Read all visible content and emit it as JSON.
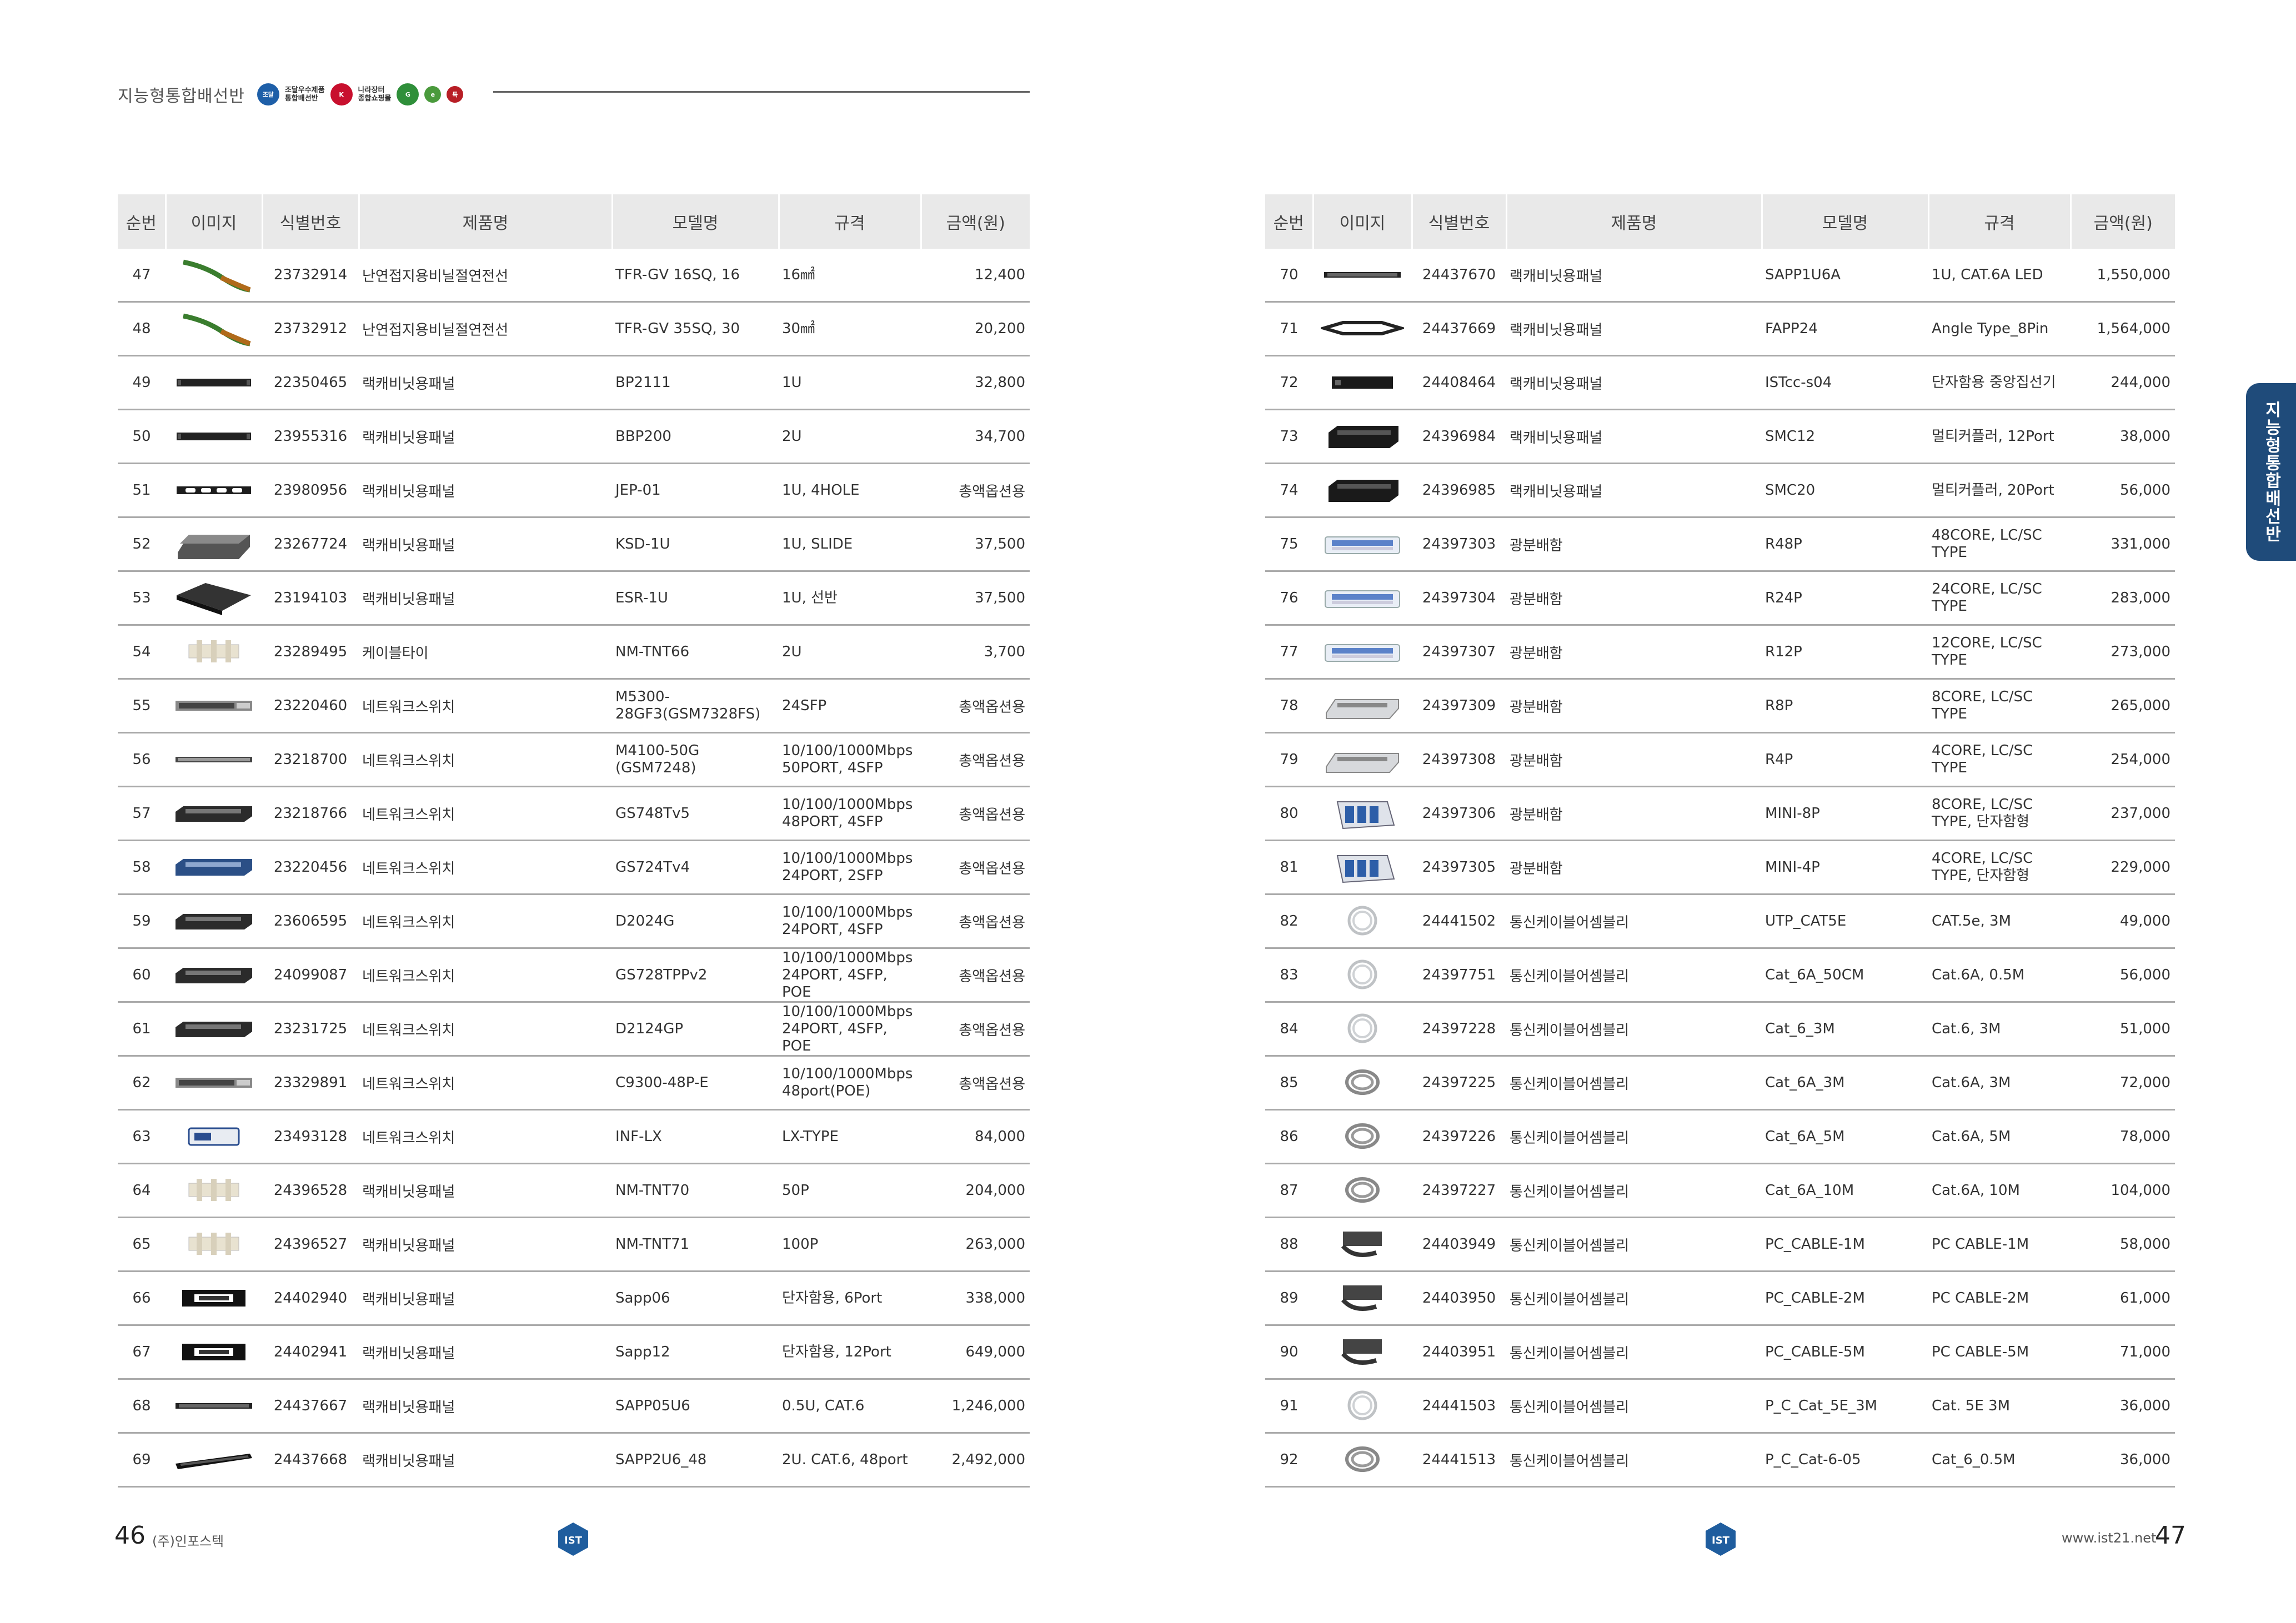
{
  "header": {
    "title": "지능형통합배선반"
  },
  "columns": [
    "순번",
    "이미지",
    "식별번호",
    "제품명",
    "모델명",
    "규격",
    "금액(원)"
  ],
  "left_rows": [
    {
      "no": "47",
      "id": "23732914",
      "name": "난연접지용비닐절연전선",
      "model": "TFR-GV 16SQ, 16",
      "spec": "16㎟",
      "price": "12,400",
      "img": "green-wire"
    },
    {
      "no": "48",
      "id": "23732912",
      "name": "난연접지용비닐절연전선",
      "model": "TFR-GV 35SQ, 30",
      "spec": "30㎟",
      "price": "20,200",
      "img": "green-wire"
    },
    {
      "no": "49",
      "id": "22350465",
      "name": "랙캐비닛용패널",
      "model": "BP2111",
      "spec": "1U",
      "price": "32,800",
      "img": "blank-panel"
    },
    {
      "no": "50",
      "id": "23955316",
      "name": "랙캐비닛용패널",
      "model": "BBP200",
      "spec": "2U",
      "price": "34,700",
      "img": "blank-panel"
    },
    {
      "no": "51",
      "id": "23980956",
      "name": "랙캐비닛용패널",
      "model": "JEP-01",
      "spec": "1U, 4HOLE",
      "price": "총액옵션용",
      "img": "hole-panel"
    },
    {
      "no": "52",
      "id": "23267724",
      "name": "랙캐비닛용패널",
      "model": "KSD-1U",
      "spec": "1U, SLIDE",
      "price": "37,500",
      "img": "slide-shelf"
    },
    {
      "no": "53",
      "id": "23194103",
      "name": "랙캐비닛용패널",
      "model": "ESR-1U",
      "spec": "1U, 선반",
      "price": "37,500",
      "img": "shelf"
    },
    {
      "no": "54",
      "id": "23289495",
      "name": "케이블타이",
      "model": "NM-TNT66",
      "spec": "2U",
      "price": "3,700",
      "img": "cable-tie"
    },
    {
      "no": "55",
      "id": "23220460",
      "name": "네트워크스위치",
      "model": "M5300-28GF3(GSM7328FS)",
      "spec": "24SFP",
      "price": "총액옵션용",
      "img": "switch-grey"
    },
    {
      "no": "56",
      "id": "23218700",
      "name": "네트워크스위치",
      "model": "M4100-50G (GSM7248)",
      "spec": "10/100/1000Mbps 50PORT, 4SFP",
      "price": "총액옵션용",
      "img": "switch-slim"
    },
    {
      "no": "57",
      "id": "23218766",
      "name": "네트워크스위치",
      "model": "GS748Tv5",
      "spec": "10/100/1000Mbps 48PORT, 4SFP",
      "price": "총액옵션용",
      "img": "switch-dark"
    },
    {
      "no": "58",
      "id": "23220456",
      "name": "네트워크스위치",
      "model": "GS724Tv4",
      "spec": "10/100/1000Mbps 24PORT, 2SFP",
      "price": "총액옵션용",
      "img": "switch-blue"
    },
    {
      "no": "59",
      "id": "23606595",
      "name": "네트워크스위치",
      "model": "D2024G",
      "spec": "10/100/1000Mbps 24PORT, 4SFP",
      "price": "총액옵션용",
      "img": "switch-dark"
    },
    {
      "no": "60",
      "id": "24099087",
      "name": "네트워크스위치",
      "model": "GS728TPPv2",
      "spec": "10/100/1000Mbps 24PORT, 4SFP, POE",
      "price": "총액옵션용",
      "img": "switch-dark"
    },
    {
      "no": "61",
      "id": "23231725",
      "name": "네트워크스위치",
      "model": "D2124GP",
      "spec": "10/100/1000Mbps 24PORT, 4SFP, POE",
      "price": "총액옵션용",
      "img": "switch-dark"
    },
    {
      "no": "62",
      "id": "23329891",
      "name": "네트워크스위치",
      "model": "C9300-48P-E",
      "spec": "10/100/1000Mbps 48port(POE)",
      "price": "총액옵션용",
      "img": "switch-grey"
    },
    {
      "no": "63",
      "id": "23493128",
      "name": "네트워크스위치",
      "model": "INF-LX",
      "spec": "LX-TYPE",
      "price": "84,000",
      "img": "sfp-module"
    },
    {
      "no": "64",
      "id": "24396528",
      "name": "랙캐비닛용패널",
      "model": "NM-TNT70",
      "spec": "50P",
      "price": "204,000",
      "img": "cable-tie"
    },
    {
      "no": "65",
      "id": "24396527",
      "name": "랙캐비닛용패널",
      "model": "NM-TNT71",
      "spec": "100P",
      "price": "263,000",
      "img": "cable-tie"
    },
    {
      "no": "66",
      "id": "24402940",
      "name": "랙캐비닛용패널",
      "model": "Sapp06",
      "spec": "단자함용, 6Port",
      "price": "338,000",
      "img": "small-panel"
    },
    {
      "no": "67",
      "id": "24402941",
      "name": "랙캐비닛용패널",
      "model": "Sapp12",
      "spec": "단자함용, 12Port",
      "price": "649,000",
      "img": "small-panel"
    },
    {
      "no": "68",
      "id": "24437667",
      "name": "랙캐비닛용패널",
      "model": "SAPP05U6",
      "spec": "0.5U, CAT.6",
      "price": "1,246,000",
      "img": "patch-panel"
    },
    {
      "no": "69",
      "id": "24437668",
      "name": "랙캐비닛용패널",
      "model": "SAPP2U6_48",
      "spec": "2U. CAT.6, 48port",
      "price": "2,492,000",
      "img": "patch-panel-angled"
    }
  ],
  "right_rows": [
    {
      "no": "70",
      "id": "24437670",
      "name": "랙캐비닛용패널",
      "model": "SAPP1U6A",
      "spec": "1U, CAT.6A LED",
      "price": "1,550,000",
      "img": "patch-panel"
    },
    {
      "no": "71",
      "id": "24437669",
      "name": "랙캐비닛용패널",
      "model": "FAPP24",
      "spec": "Angle Type_8Pin",
      "price": "1,564,000",
      "img": "angle-panel"
    },
    {
      "no": "72",
      "id": "24408464",
      "name": "랙캐비닛용패널",
      "model": "ISTcc-s04",
      "spec": "단자함용 중앙집선기",
      "price": "244,000",
      "img": "black-box"
    },
    {
      "no": "73",
      "id": "24396984",
      "name": "랙캐비닛용패널",
      "model": "SMC12",
      "spec": "멀티커플러, 12Port",
      "price": "38,000",
      "img": "coupler"
    },
    {
      "no": "74",
      "id": "24396985",
      "name": "랙캐비닛용패널",
      "model": "SMC20",
      "spec": "멀티커플러, 20Port",
      "price": "56,000",
      "img": "coupler"
    },
    {
      "no": "75",
      "id": "24397303",
      "name": "광분배함",
      "model": "R48P",
      "spec": "48CORE, LC/SC TYPE",
      "price": "331,000",
      "img": "fiber-tray"
    },
    {
      "no": "76",
      "id": "24397304",
      "name": "광분배함",
      "model": "R24P",
      "spec": "24CORE, LC/SC TYPE",
      "price": "283,000",
      "img": "fiber-tray"
    },
    {
      "no": "77",
      "id": "24397307",
      "name": "광분배함",
      "model": "R12P",
      "spec": "12CORE, LC/SC TYPE",
      "price": "273,000",
      "img": "fiber-tray"
    },
    {
      "no": "78",
      "id": "24397309",
      "name": "광분배함",
      "model": "R8P",
      "spec": "8CORE, LC/SC TYPE",
      "price": "265,000",
      "img": "fiber-tray-grey"
    },
    {
      "no": "79",
      "id": "24397308",
      "name": "광분배함",
      "model": "R4P",
      "spec": "4CORE, LC/SC TYPE",
      "price": "254,000",
      "img": "fiber-tray-grey"
    },
    {
      "no": "80",
      "id": "24397306",
      "name": "광분배함",
      "model": "MINI-8P",
      "spec": "8CORE, LC/SC TYPE, 단자함형",
      "price": "237,000",
      "img": "mini-box"
    },
    {
      "no": "81",
      "id": "24397305",
      "name": "광분배함",
      "model": "MINI-4P",
      "spec": "4CORE, LC/SC TYPE, 단자함형",
      "price": "229,000",
      "img": "mini-box"
    },
    {
      "no": "82",
      "id": "24441502",
      "name": "통신케이블어셈블리",
      "model": "UTP_CAT5E",
      "spec": "CAT.5e, 3M",
      "price": "49,000",
      "img": "cable-coil"
    },
    {
      "no": "83",
      "id": "24397751",
      "name": "통신케이블어셈블리",
      "model": "Cat_6A_50CM",
      "spec": "Cat.6A, 0.5M",
      "price": "56,000",
      "img": "cable-coil"
    },
    {
      "no": "84",
      "id": "24397228",
      "name": "통신케이블어셈블리",
      "model": "Cat_6_3M",
      "spec": "Cat.6, 3M",
      "price": "51,000",
      "img": "cable-coil"
    },
    {
      "no": "85",
      "id": "24397225",
      "name": "통신케이블어셈블리",
      "model": "Cat_6A_3M",
      "spec": "Cat.6A, 3M",
      "price": "72,000",
      "img": "cable-coil-grey"
    },
    {
      "no": "86",
      "id": "24397226",
      "name": "통신케이블어셈블리",
      "model": "Cat_6A_5M",
      "spec": "Cat.6A, 5M",
      "price": "78,000",
      "img": "cable-coil-grey"
    },
    {
      "no": "87",
      "id": "24397227",
      "name": "통신케이블어셈블리",
      "model": "Cat_6A_10M",
      "spec": "Cat.6A, 10M",
      "price": "104,000",
      "img": "cable-coil-grey"
    },
    {
      "no": "88",
      "id": "24403949",
      "name": "통신케이블어셈블리",
      "model": "PC_CABLE-1M",
      "spec": "PC CABLE-1M",
      "price": "58,000",
      "img": "flat-cable"
    },
    {
      "no": "89",
      "id": "24403950",
      "name": "통신케이블어셈블리",
      "model": "PC_CABLE-2M",
      "spec": "PC CABLE-2M",
      "price": "61,000",
      "img": "flat-cable"
    },
    {
      "no": "90",
      "id": "24403951",
      "name": "통신케이블어셈블리",
      "model": "PC_CABLE-5M",
      "spec": "PC CABLE-5M",
      "price": "71,000",
      "img": "flat-cable"
    },
    {
      "no": "91",
      "id": "24441503",
      "name": "통신케이블어셈블리",
      "model": "P_C_Cat_5E_3M",
      "spec": "Cat. 5E 3M",
      "price": "36,000",
      "img": "cable-coil"
    },
    {
      "no": "92",
      "id": "24441513",
      "name": "통신케이블어셈블리",
      "model": "P_C_Cat-6-05",
      "spec": "Cat_6_0.5M",
      "price": "36,000",
      "img": "cable-coil-grey"
    }
  ],
  "footer": {
    "left_page": "46",
    "company": "(주)인포스텍",
    "url": "www.ist21.net",
    "right_page": "47",
    "badge": "IST"
  },
  "side_tab": "지능형통합배선반"
}
